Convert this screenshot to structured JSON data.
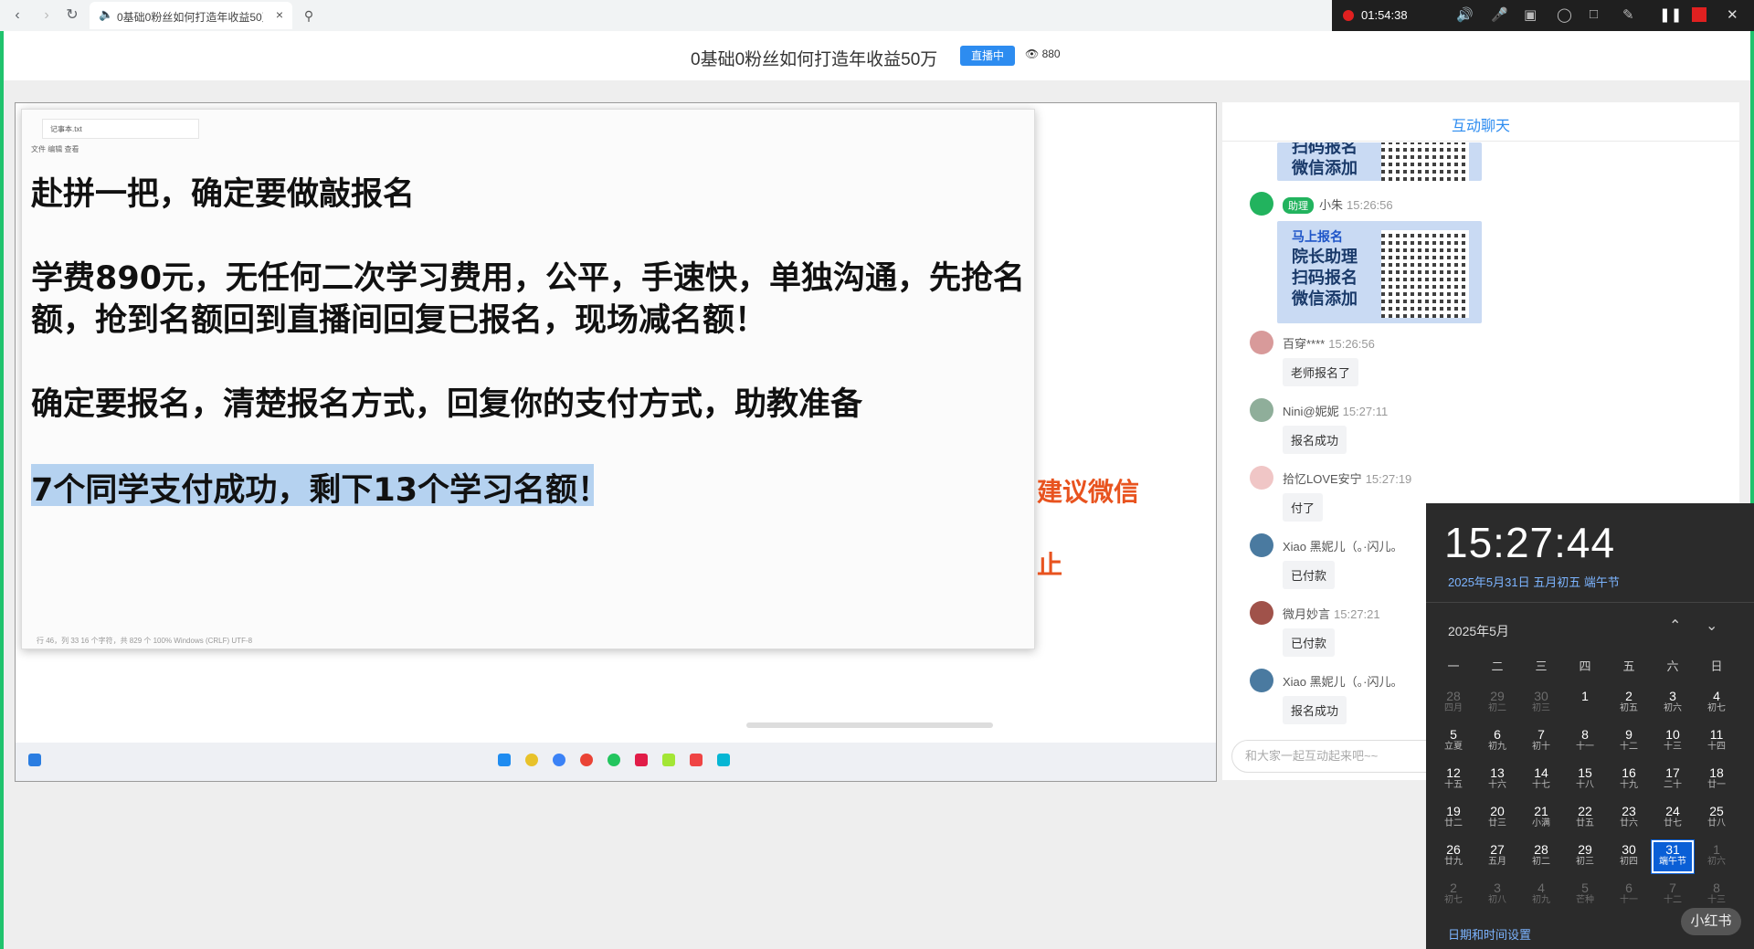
{
  "browser": {
    "tab_title": "0基础0粉丝如何打造年收益50万",
    "close": "×"
  },
  "recorder": {
    "time": "01:54:38"
  },
  "header": {
    "title": "0基础0粉丝如何打造年收益50万",
    "live_badge": "直播中",
    "viewers": "880"
  },
  "notepad": {
    "tab": "记事本.txt",
    "menu": "文件   编辑   查看",
    "lines": [
      "赴拼一把，确定要做敲报名",
      "学费890元，无任何二次学习费用，公平，手速快，单独沟通，先抢名",
      "额，抢到名额回到直播间回复已报名，现场减名额！",
      "确定要报名，清楚报名方式，回复你的支付方式，助教准备",
      "7个同学支付成功，剩下13个学习名额！"
    ],
    "status": "行 46，列 33    16 个字符，共 829 个                                    100%      Windows (CRLF)      UTF-8"
  },
  "side_text": {
    "a": "建议微信",
    "b": "止"
  },
  "chat": {
    "title": "互动聊天",
    "card_top_lines": [
      "扫码报名",
      "微信添加"
    ],
    "assistant": {
      "role": "助理",
      "name": "小朱",
      "time": "15:26:56"
    },
    "card_lines": [
      "马上报名",
      "院长助理",
      "扫码报名",
      "微信添加"
    ],
    "messages": [
      {
        "name": "百穿****",
        "time": "15:26:56",
        "text": "老师报名了"
      },
      {
        "name": "Nini@妮妮",
        "time": "15:27:11",
        "text": "报名成功"
      },
      {
        "name": "拾忆LOVE安宁",
        "time": "15:27:19",
        "text": "付了"
      },
      {
        "name": "Xiao 黑妮儿（。·闪儿。",
        "time": "",
        "text": "已付款"
      },
      {
        "name": "微月妙言",
        "time": "15:27:21",
        "text": "已付款"
      },
      {
        "name": "Xiao 黑妮儿（。·闪儿。",
        "time": "",
        "text": "报名成功"
      }
    ],
    "input_placeholder": "和大家一起互动起来吧~~"
  },
  "calendar": {
    "time": "15:27:44",
    "date": "2025年5月31日 五月初五 端午节",
    "month": "2025年5月",
    "weekdays": [
      "一",
      "二",
      "三",
      "四",
      "五",
      "六",
      "日"
    ],
    "weeks": [
      [
        [
          "28",
          "四月",
          1
        ],
        [
          "29",
          "初二",
          1
        ],
        [
          "30",
          "初三",
          1
        ],
        [
          "1",
          "",
          0
        ],
        [
          "2",
          "初五",
          0
        ],
        [
          "3",
          "初六",
          0
        ],
        [
          "4",
          "初七",
          0
        ]
      ],
      [
        [
          "5",
          "立夏",
          0
        ],
        [
          "6",
          "初九",
          0
        ],
        [
          "7",
          "初十",
          0
        ],
        [
          "8",
          "十一",
          0
        ],
        [
          "9",
          "十二",
          0
        ],
        [
          "10",
          "十三",
          0
        ],
        [
          "11",
          "十四",
          0
        ]
      ],
      [
        [
          "12",
          "十五",
          0
        ],
        [
          "13",
          "十六",
          0
        ],
        [
          "14",
          "十七",
          0
        ],
        [
          "15",
          "十八",
          0
        ],
        [
          "16",
          "十九",
          0
        ],
        [
          "17",
          "二十",
          0
        ],
        [
          "18",
          "廿一",
          0
        ]
      ],
      [
        [
          "19",
          "廿二",
          0
        ],
        [
          "20",
          "廿三",
          0
        ],
        [
          "21",
          "小满",
          0
        ],
        [
          "22",
          "廿五",
          0
        ],
        [
          "23",
          "廿六",
          0
        ],
        [
          "24",
          "廿七",
          0
        ],
        [
          "25",
          "廿八",
          0
        ]
      ],
      [
        [
          "26",
          "廿九",
          0
        ],
        [
          "27",
          "五月",
          0
        ],
        [
          "28",
          "初二",
          0
        ],
        [
          "29",
          "初三",
          0
        ],
        [
          "30",
          "初四",
          0
        ],
        [
          "31",
          "端午节",
          2
        ],
        [
          "1",
          "初六",
          1
        ]
      ],
      [
        [
          "2",
          "初七",
          1
        ],
        [
          "3",
          "初八",
          1
        ],
        [
          "4",
          "初九",
          1
        ],
        [
          "5",
          "芒种",
          1
        ],
        [
          "6",
          "十一",
          1
        ],
        [
          "7",
          "十二",
          1
        ],
        [
          "8",
          "十三",
          1
        ]
      ]
    ],
    "settings": "日期和时间设置"
  },
  "watermark": "小红书"
}
